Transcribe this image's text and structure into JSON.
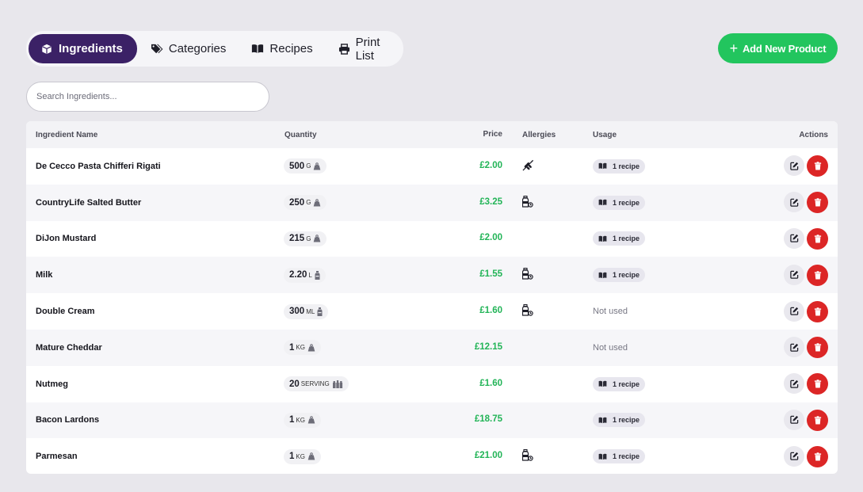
{
  "tabs": [
    {
      "label": "Ingredients",
      "icon": "cube-icon",
      "active": true
    },
    {
      "label": "Categories",
      "icon": "tags-icon",
      "active": false
    },
    {
      "label": "Recipes",
      "icon": "book-icon",
      "active": false
    },
    {
      "label": "Print List",
      "icon": "printer-icon",
      "active": false
    }
  ],
  "add_button": {
    "label": "Add New Product",
    "icon": "plus-icon"
  },
  "search": {
    "placeholder": "Search Ingredients...",
    "value": ""
  },
  "colors": {
    "accent": "#3b2166",
    "success": "#22c55e",
    "danger": "#dc2626",
    "price": "#22b457"
  },
  "table": {
    "headers": {
      "name": "Ingredient Name",
      "quantity": "Quantity",
      "price": "Price",
      "allergies": "Allergies",
      "usage": "Usage",
      "actions": "Actions"
    },
    "rows": [
      {
        "name": "De Cecco Pasta Chifferi Rigati",
        "qty": "500",
        "unit": "G",
        "unit_icon": "weight-icon",
        "price": "£2.00",
        "allergy": "wheat-icon",
        "usage": "1 recipe"
      },
      {
        "name": "CountryLife Salted Butter",
        "qty": "250",
        "unit": "G",
        "unit_icon": "weight-icon",
        "price": "£3.25",
        "allergy": "milk-bottle-icon",
        "usage": "1 recipe"
      },
      {
        "name": "DiJon Mustard",
        "qty": "215",
        "unit": "G",
        "unit_icon": "weight-icon",
        "price": "£2.00",
        "allergy": "",
        "usage": "1 recipe"
      },
      {
        "name": "Milk",
        "qty": "2.20",
        "unit": "L",
        "unit_icon": "bottle-icon",
        "price": "£1.55",
        "allergy": "milk-bottle-icon",
        "usage": "1 recipe"
      },
      {
        "name": "Double Cream",
        "qty": "300",
        "unit": "ML",
        "unit_icon": "bottle-icon",
        "price": "£1.60",
        "allergy": "milk-bottle-icon",
        "usage": "Not used"
      },
      {
        "name": "Mature Cheddar",
        "qty": "1",
        "unit": "KG",
        "unit_icon": "weight-icon",
        "price": "£12.15",
        "allergy": "",
        "usage": "Not used"
      },
      {
        "name": "Nutmeg",
        "qty": "20",
        "unit": "SERVING",
        "unit_icon": "servings-icon",
        "price": "£1.60",
        "allergy": "",
        "usage": "1 recipe"
      },
      {
        "name": "Bacon Lardons",
        "qty": "1",
        "unit": "KG",
        "unit_icon": "weight-icon",
        "price": "£18.75",
        "allergy": "",
        "usage": "1 recipe"
      },
      {
        "name": "Parmesan",
        "qty": "1",
        "unit": "KG",
        "unit_icon": "weight-icon",
        "price": "£21.00",
        "allergy": "milk-bottle-icon",
        "usage": "1 recipe"
      }
    ]
  }
}
